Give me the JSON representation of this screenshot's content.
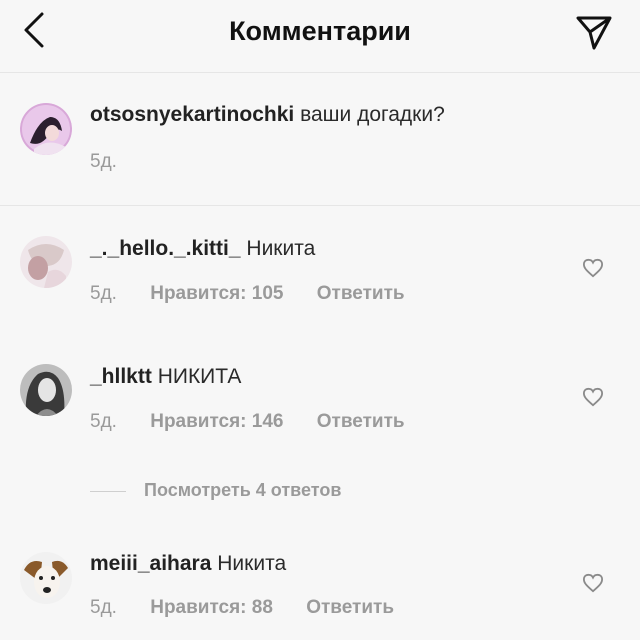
{
  "header": {
    "title": "Комментарии",
    "back_icon": "chevron-left-icon",
    "share_icon": "paper-plane-icon"
  },
  "caption": {
    "username": "otsosnyekartinochki",
    "text": "ваши догадки?",
    "time": "5д."
  },
  "comments": [
    {
      "username": "_._hello._.kitti_",
      "text": "Никита",
      "time": "5д.",
      "likes": "Нравится: 105",
      "reply": "Ответить"
    },
    {
      "username": "_hllktt",
      "text": "НИКИТА",
      "time": "5д.",
      "likes": "Нравится: 146",
      "reply": "Ответить"
    },
    {
      "username": "meiii_aihara",
      "text": "Никита",
      "time": "5д.",
      "likes": "Нравится: 88",
      "reply": "Ответить"
    }
  ],
  "view_replies": "Посмотреть 4 ответов",
  "colors": {
    "text": "#262626",
    "muted": "#9a9a9a",
    "divider": "#e6e6e6",
    "background": "#f7f7f7"
  }
}
